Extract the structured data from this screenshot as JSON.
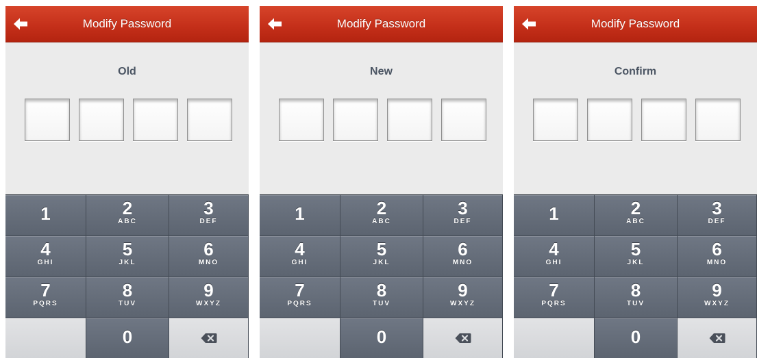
{
  "screens": [
    {
      "title": "Modify Password",
      "prompt": "Old",
      "back_icon": "arrow-left-icon"
    },
    {
      "title": "Modify Password",
      "prompt": "New",
      "back_icon": "arrow-left-icon"
    },
    {
      "title": "Modify Password",
      "prompt": "Confirm",
      "back_icon": "arrow-left-icon"
    }
  ],
  "keypad": {
    "keys": [
      {
        "digit": "1",
        "letters": ""
      },
      {
        "digit": "2",
        "letters": "ABC"
      },
      {
        "digit": "3",
        "letters": "DEF"
      },
      {
        "digit": "4",
        "letters": "GHI"
      },
      {
        "digit": "5",
        "letters": "JKL"
      },
      {
        "digit": "6",
        "letters": "MNO"
      },
      {
        "digit": "7",
        "letters": "PQRS"
      },
      {
        "digit": "8",
        "letters": "TUV"
      },
      {
        "digit": "9",
        "letters": "WXYZ"
      },
      {
        "digit": "0",
        "letters": ""
      }
    ],
    "delete_icon": "backspace-icon"
  },
  "colors": {
    "navbar": "#c5301a",
    "background": "#ebebeb",
    "key_dark": "#636b77",
    "key_light": "#dadcdf",
    "prompt_text": "#4b5563"
  }
}
